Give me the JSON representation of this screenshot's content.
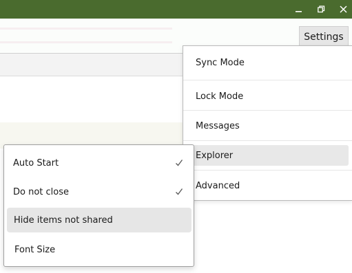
{
  "window": {
    "controls": [
      "minimize-icon",
      "restore-icon",
      "close-icon"
    ],
    "titlebar_color": "#4a6b2e"
  },
  "toolbar": {
    "settings_label": "Settings"
  },
  "settings_menu": {
    "items": [
      {
        "label": "Sync Mode"
      },
      {
        "label": "Lock Mode"
      },
      {
        "label": "Messages"
      },
      {
        "label": "Explorer",
        "highlighted": true
      },
      {
        "label": "Advanced"
      }
    ]
  },
  "options_menu": {
    "items": [
      {
        "label": "Auto Start",
        "checked": true
      },
      {
        "label": "Do not close",
        "checked": true
      },
      {
        "label": "Hide items not shared",
        "checked": false,
        "highlighted": true
      },
      {
        "label": "Font Size",
        "checked": false
      }
    ]
  }
}
